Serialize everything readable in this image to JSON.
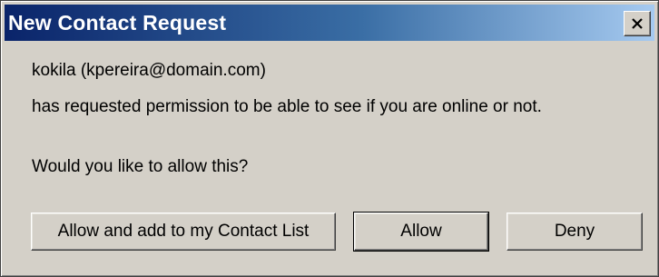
{
  "window": {
    "title": "New Contact Request",
    "close_label": "×"
  },
  "message": {
    "line1": "kokila (kpereira@domain.com)",
    "line2": "has requested permission to be able to see if you are online or not.",
    "line3": "Would you like to allow this?"
  },
  "buttons": {
    "allow_and_add": "Allow and add to my Contact List",
    "allow": "Allow",
    "deny": "Deny"
  },
  "colors": {
    "titlebar_start": "#0a246a",
    "titlebar_end": "#a6caf0",
    "face": "#d4d0c8"
  }
}
